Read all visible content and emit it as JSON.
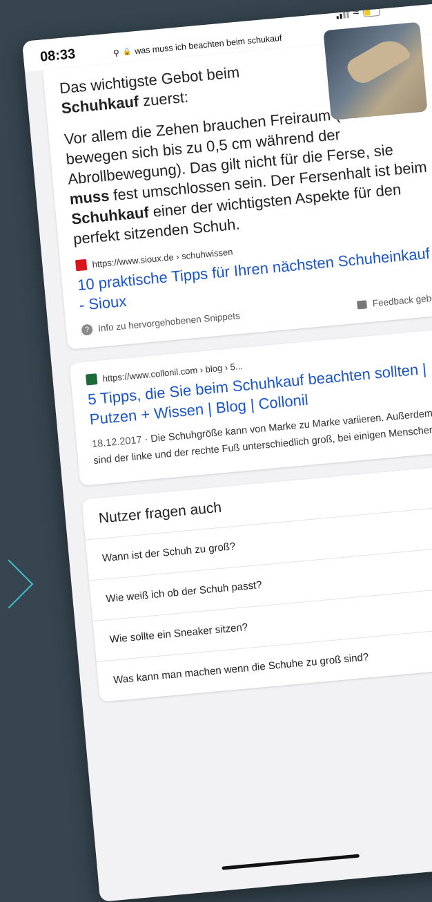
{
  "status_bar": {
    "time": "08:33"
  },
  "url_bar": {
    "query": "was muss ich beachten beim schukauf"
  },
  "featured_snippet": {
    "heading_plain": "Das wichtigste Gebot beim ",
    "heading_bold": "Schuhkauf",
    "heading_end": " zuerst:",
    "body": [
      {
        "t": "Vor allem die Zehen brauchen Freiraum (sie bewegen sich bis zu 0,5 cm während der Abrollbewegung). Das gilt nicht für die Ferse, sie ",
        "b": false
      },
      {
        "t": "muss",
        "b": true
      },
      {
        "t": " fest umschlossen sein. Der Fersenhalt ist beim ",
        "b": false
      },
      {
        "t": "Schuhkauf",
        "b": true
      },
      {
        "t": " einer der wichtigsten Aspekte für den perfekt sitzenden Schuh.",
        "b": false
      }
    ],
    "source_url": "https://www.sioux.de › schuhwissen",
    "title": "10 praktische Tipps für Ihren nächsten Schuheinkauf - Sioux",
    "info_label": "Info zu hervorgehobenen Snippets",
    "feedback_label": "Feedback geben"
  },
  "result2": {
    "source_url": "https://www.collonil.com › blog › 5...",
    "title": "5 Tipps, die Sie beim Schuhkauf beachten sollten | Putzen + Wissen | Blog | Collonil",
    "date": "18.12.2017",
    "separator": " · ",
    "snippet": "Die Schuhgröße kann von Marke zu Marke variieren. Außerdem sind der linke und der rechte Fuß unterschiedlich groß, bei einigen Menschen ..."
  },
  "people_also_ask": {
    "title": "Nutzer fragen auch",
    "questions": [
      "Wann ist der Schuh zu groß?",
      "Wie weiß ich ob der Schuh passt?",
      "Wie sollte ein Sneaker sitzen?",
      "Was kann man machen wenn die Schuhe zu groß sind?"
    ]
  },
  "colors": {
    "background": "#36454f",
    "accent": "#3fc1c9",
    "link": "#1a55c7"
  }
}
